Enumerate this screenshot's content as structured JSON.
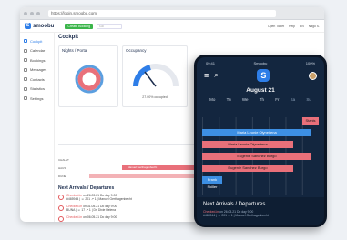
{
  "browser": {
    "url": "https://login.smoobu.com"
  },
  "header": {
    "logo": "smoobu",
    "green_button": "Create Booking",
    "search_placeholder": "Go",
    "right_items": [
      "Open Ticket",
      "Help",
      "EN",
      "Nago S."
    ]
  },
  "sidebar": {
    "items": [
      {
        "label": "Cockpit",
        "active": true
      },
      {
        "label": "Calendar"
      },
      {
        "label": "Bookings"
      },
      {
        "label": "Messages"
      },
      {
        "label": "Contacts"
      },
      {
        "label": "Statistics"
      },
      {
        "label": "Settings"
      }
    ]
  },
  "main": {
    "title": "Cockpit",
    "nights_card": {
      "title": "Nights / Portal"
    },
    "occupancy_card": {
      "title": "Occupancy",
      "caption": "27.00% occupied"
    },
    "timeline": {
      "rows": [
        "CHALET",
        "HAUS",
        "DUNE"
      ],
      "bar_label": "Manuel Gerthagenbecht"
    },
    "arrivals": {
      "title": "Next Arrivals / Departures",
      "items": [
        {
          "status": "Checked-in",
          "date": "on 26.03.21 Do day 9:00",
          "detail": "#465944 | ☺ 201 ↗ 1 | Manuel Gerthagenbecht"
        },
        {
          "status": "Checked-in",
          "date": "on 31.05.21 Do day 9:00",
          "detail": "BUNA | ☺ 17 ↗ 1 | Dr. Dixie Helena"
        },
        {
          "status": "Checked-in",
          "date": "on 06.05.21 Do day 9:00",
          "detail": ""
        }
      ]
    }
  },
  "phone": {
    "time": "09:41",
    "carrier": "Smoobu",
    "battery": "100%",
    "date": "August 21",
    "weekdays": [
      "Mo",
      "Tu",
      "We",
      "Th",
      "Fr",
      "Sa",
      "Su"
    ],
    "bars": [
      {
        "label": "Stanis",
        "color": "red"
      },
      {
        "label": "Maria Leonie Olyneitena",
        "color": "blue"
      },
      {
        "label": "Maria Leonie Olyneitena",
        "color": "red"
      },
      {
        "label": "Eugenie Sanchez Burgo",
        "color": "red"
      },
      {
        "label": "Eugenie Sanchez Burgo",
        "color": "red"
      },
      {
        "label": "Frank Skiller",
        "color": "blue"
      }
    ],
    "arrivals": {
      "title": "Next Arrivals / Departures",
      "status": "Checked-in",
      "date": "on 26.03.21 Do day 9:00",
      "detail": "#465944 | ☺ 201 ↗ 1 | Manuel Gerthagenbecht"
    }
  },
  "colors": {
    "accent": "#2e7ee8",
    "occupancy_bar": "#e9707a",
    "donut_ring": "#5b9fe0"
  }
}
